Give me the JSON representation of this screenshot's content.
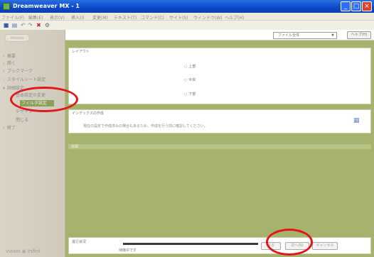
{
  "window": {
    "title": "Dreamweaver MX - 1",
    "buttons": {
      "minimize": "_",
      "maximize": "□",
      "close": "×"
    }
  },
  "menu": [
    "ファイル(F)",
    "編集(E)",
    "表示(V)",
    "挿入(I)",
    "変更(M)",
    "テキスト(T)",
    "コマンド(C)",
    "サイト(S)",
    "ウィンドウ(W)",
    "ヘルプ(H)"
  ],
  "toolbar": {
    "icons": [
      "save-icon",
      "copy-icon",
      "undo-icon",
      "redo-icon",
      "delete-icon",
      "refresh-icon"
    ]
  },
  "sidebar": {
    "logo_label": "dreams",
    "items": [
      {
        "label": "概要",
        "level": 0
      },
      {
        "label": "開く",
        "level": 0
      },
      {
        "label": "ブックマーク",
        "level": 0
      },
      {
        "label": "スタイルシート設定",
        "level": 0
      },
      {
        "label": "詳細設定",
        "level": 0
      },
      {
        "label": "基本設定の変更",
        "level": 1
      },
      {
        "label": "フィルタ設定",
        "level": 1,
        "selected": true
      },
      {
        "label": "デザイン",
        "level": 1
      },
      {
        "label": "閉じる",
        "level": 1
      },
      {
        "label": "終了",
        "level": 0
      }
    ],
    "footer_logo": {
      "left": "vision",
      "right": "Infini"
    }
  },
  "topbar": {
    "dropdown_value": "ファイル全体",
    "help_label": "ヘルプ(H)"
  },
  "panels": {
    "scope": {
      "heading": "レイアウト",
      "options": [
        "上部",
        "中央",
        "下部"
      ]
    },
    "settings": {
      "heading": "インデックスの作成",
      "message": "現在の設定で作成済みの場合もあるため、作成を行う前に確認してください。"
    },
    "detail": {
      "heading": "詳細"
    }
  },
  "bottom": {
    "label": "進行状況",
    "status": "待機中です",
    "progress": 0.78,
    "back_label": "戻る",
    "next_label": "次へ(N)",
    "cancel_label": "キャンセル"
  },
  "colors": {
    "accent": "#a5b36f",
    "selected": "#8d9f58",
    "annotation": "#e3161b"
  }
}
